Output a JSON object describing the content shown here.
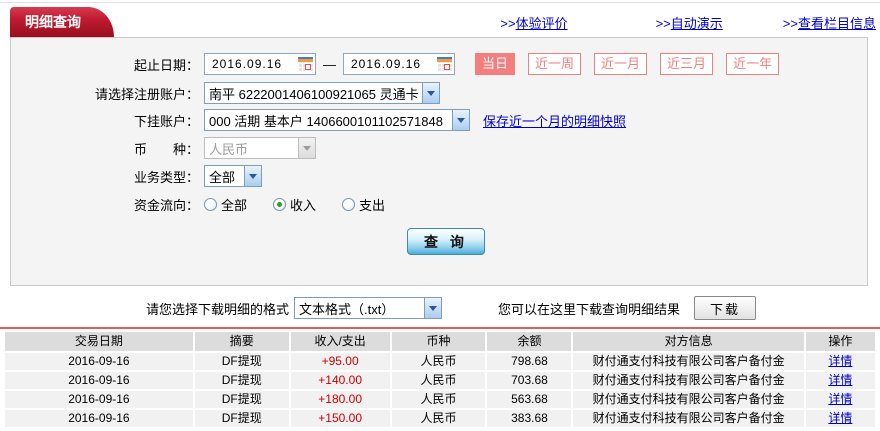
{
  "header": {
    "tab_title": "明细查询",
    "links": [
      {
        "prefix": ">>",
        "label": "体验评价"
      },
      {
        "prefix": ">>",
        "label": "自动演示"
      },
      {
        "prefix": ">>",
        "label": "查看栏目信息"
      }
    ]
  },
  "form": {
    "date_label": "起止日期：",
    "date_from": "2016.09.16",
    "date_separator": "—",
    "date_to": "2016.09.16",
    "quick_buttons": [
      {
        "label": "当日",
        "active": true
      },
      {
        "label": "近一周",
        "active": false
      },
      {
        "label": "近一月",
        "active": false
      },
      {
        "label": "近三月",
        "active": false
      },
      {
        "label": "近一年",
        "active": false
      }
    ],
    "account_label": "请选择注册账户：",
    "account_value": "南平 6222001406100921065 灵通卡",
    "sub_account_label": "下挂账户：",
    "sub_account_value": "000 活期 基本户 1406600101102571848",
    "snapshot_link": "保存近一个月的明细快照",
    "currency_label": "币　　种：",
    "currency_value": "人民币",
    "biz_type_label": "业务类型：",
    "biz_type_value": "全部",
    "flow_label": "资金流向：",
    "flow_options": [
      {
        "label": "全部",
        "selected": false
      },
      {
        "label": "收入",
        "selected": true
      },
      {
        "label": "支出",
        "selected": false
      }
    ],
    "query_button": "查 询"
  },
  "download": {
    "format_label": "请您选择下载明细的格式",
    "format_value": "文本格式（.txt）",
    "hint": "您可以在这里下载查询明细结果",
    "button_label": "下载"
  },
  "table": {
    "headers": [
      "交易日期",
      "摘要",
      "收入/支出",
      "币种",
      "余额",
      "对方信息",
      "操作"
    ],
    "rows": [
      {
        "date": "2016-09-16",
        "summary": "DF提现",
        "amount": "+95.00",
        "currency": "人民币",
        "balance": "798.68",
        "counterparty": "财付通支付科技有限公司客户备付金",
        "action": "详情"
      },
      {
        "date": "2016-09-16",
        "summary": "DF提现",
        "amount": "+140.00",
        "currency": "人民币",
        "balance": "703.68",
        "counterparty": "财付通支付科技有限公司客户备付金",
        "action": "详情"
      },
      {
        "date": "2016-09-16",
        "summary": "DF提现",
        "amount": "+180.00",
        "currency": "人民币",
        "balance": "563.68",
        "counterparty": "财付通支付科技有限公司客户备付金",
        "action": "详情"
      },
      {
        "date": "2016-09-16",
        "summary": "DF提现",
        "amount": "+150.00",
        "currency": "人民币",
        "balance": "383.68",
        "counterparty": "财付通支付科技有限公司客户备付金",
        "action": "详情"
      }
    ]
  },
  "colors": {
    "tab_red": "#b2132a",
    "accent_salmon": "#f47d7d",
    "link_blue": "#0000cc",
    "amount_red": "#cc0000",
    "divider_red": "#e25c5c",
    "header_gray": "#dcdcdc",
    "row_gray": "#f1f1f1",
    "query_btn_blue": "#4aabda"
  }
}
